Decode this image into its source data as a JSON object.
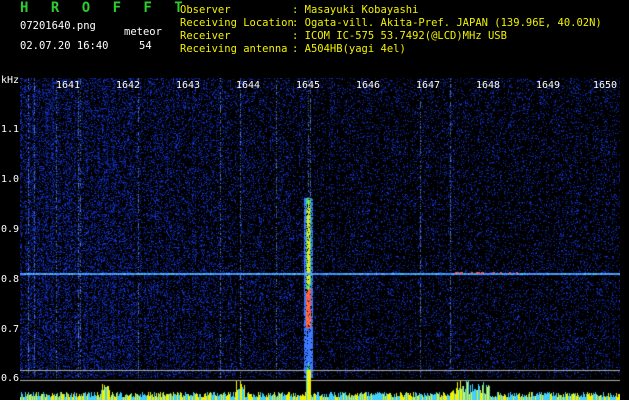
{
  "header": {
    "logo": "H R O F F T",
    "filename": "07201640.png",
    "mode_label": "meteor",
    "datetime": "02.07.20 16:40",
    "count": "54",
    "fields": [
      {
        "label": "Observer",
        "value": ": Masayuki Kobayashi"
      },
      {
        "label": "Receiving Location",
        "value": ": Ogata-vill. Akita-Pref. JAPAN (139.96E, 40.02N)"
      },
      {
        "label": "Receiver",
        "value": ": ICOM IC-575 53.7492(@LCD)MHz USB"
      },
      {
        "label": "Receiving antenna",
        "value": ": A504HB(yagi 4el)"
      }
    ]
  },
  "axis": {
    "unit": "kHz",
    "y_ticks": [
      "1.1",
      "1.0",
      "0.9",
      "0.8",
      "0.7",
      "0.6"
    ],
    "x_ticks": [
      "1641",
      "1642",
      "1643",
      "1644",
      "1645",
      "1646",
      "1647",
      "1648",
      "1649",
      "1650"
    ]
  },
  "colors": {
    "logo": "#2ecc2e",
    "header_text": "#f2f200",
    "background": "#000000",
    "signal_line": "#3a6cff",
    "baseline": "#f2f200",
    "baseline_fill": "#3fd0ff"
  }
}
